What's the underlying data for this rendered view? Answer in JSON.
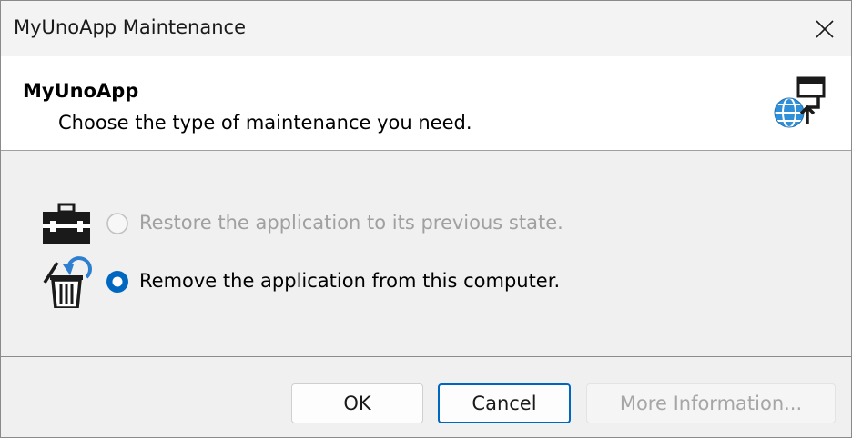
{
  "window": {
    "title": "MyUnoApp Maintenance"
  },
  "header": {
    "app_name": "MyUnoApp",
    "subtitle": "Choose the type of maintenance you need.",
    "icon": "globe-monitor-icon"
  },
  "options": [
    {
      "label": "Restore the application to its previous state.",
      "icon": "toolbox-icon",
      "selected": false,
      "enabled": false
    },
    {
      "label": "Remove the application from this computer.",
      "icon": "trash-undo-icon",
      "selected": true,
      "enabled": true
    }
  ],
  "buttons": {
    "ok": "OK",
    "cancel": "Cancel",
    "more_info": "More Information..."
  },
  "colors": {
    "accent": "#0067c0",
    "disabled_text": "#a0a0a0"
  }
}
